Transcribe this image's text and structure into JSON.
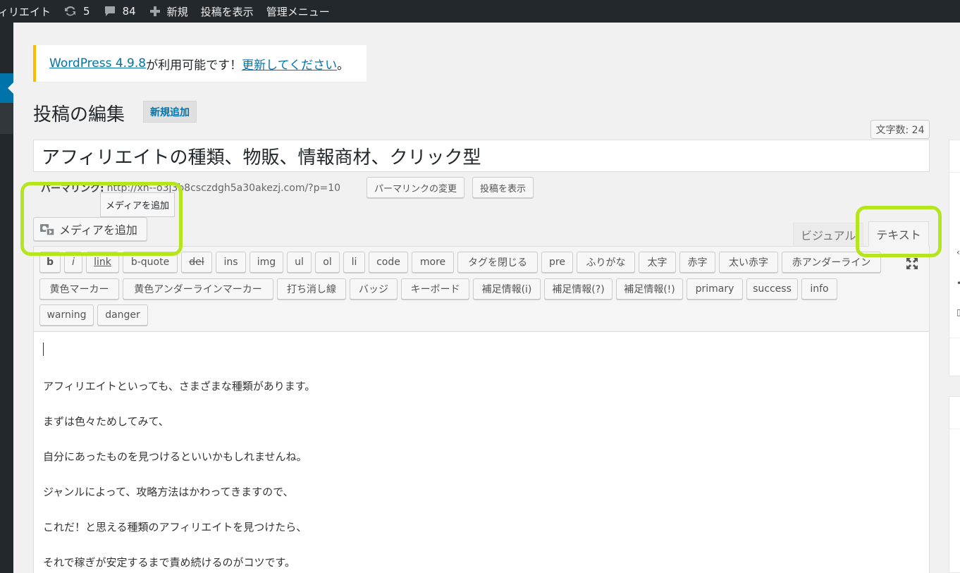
{
  "adminbar": {
    "site_name": "ィリエイト",
    "updates_count": "5",
    "comments_count": "84",
    "new_label": "新規",
    "view_post_label": "投稿を表示",
    "admin_menu_label": "管理メニュー"
  },
  "notice": {
    "version_link": "WordPress 4.9.8",
    "middle_text": " が利用可能です！",
    "update_link": "更新してください",
    "end_text": "。"
  },
  "page": {
    "title": "投稿の編集",
    "add_new_label": "新規追加",
    "word_count": "文字数: 24"
  },
  "post": {
    "title": "アフィリエイトの種類、物販、情報商材、クリック型",
    "permalink_label": "パーマリンク:",
    "permalink_url": "http://xn--o3j3b8csczdgh5a30akezj.com/?p=10",
    "change_permalink_label": "パーマリンクの変更",
    "view_post_label": "投稿を表示"
  },
  "media": {
    "tooltip": "メディアを追加",
    "button_label": "メディアを追加"
  },
  "editor_tabs": {
    "visual": "ビジュアル",
    "text": "テキスト"
  },
  "quicktags": [
    "b",
    "i",
    "link",
    "b-quote",
    "del",
    "ins",
    "img",
    "ul",
    "ol",
    "li",
    "code",
    "more",
    "タグを閉じる",
    "pre",
    "ふりがな",
    "太字",
    "赤字",
    "太い赤字",
    "赤アンダーライン",
    "黄色マーカー",
    "黄色アンダーラインマーカー",
    "打ち消し線",
    "バッジ",
    "キーボード",
    "補足情報(i)",
    "補足情報(?)",
    "補足情報(!)",
    "primary",
    "success",
    "info",
    "warning",
    "danger"
  ],
  "content_lines": [
    "アフィリエイトといっても、さまざまな種類があります。",
    "まずは色々ためしてみて、",
    "自分にあったものを見つけるといいかもしれませんね。",
    "ジャンルによって、攻略方法はかわってきますので、",
    "これだ！と思える種類のアフィリエイトを見つけたら、",
    "それで稼ぎが安定するまで責め続けるのがコツです。"
  ],
  "colors": {
    "adminbar_bg": "#23282d",
    "link": "#0073aa",
    "notice_border": "#ffba00",
    "highlight": "#b5e61d"
  }
}
